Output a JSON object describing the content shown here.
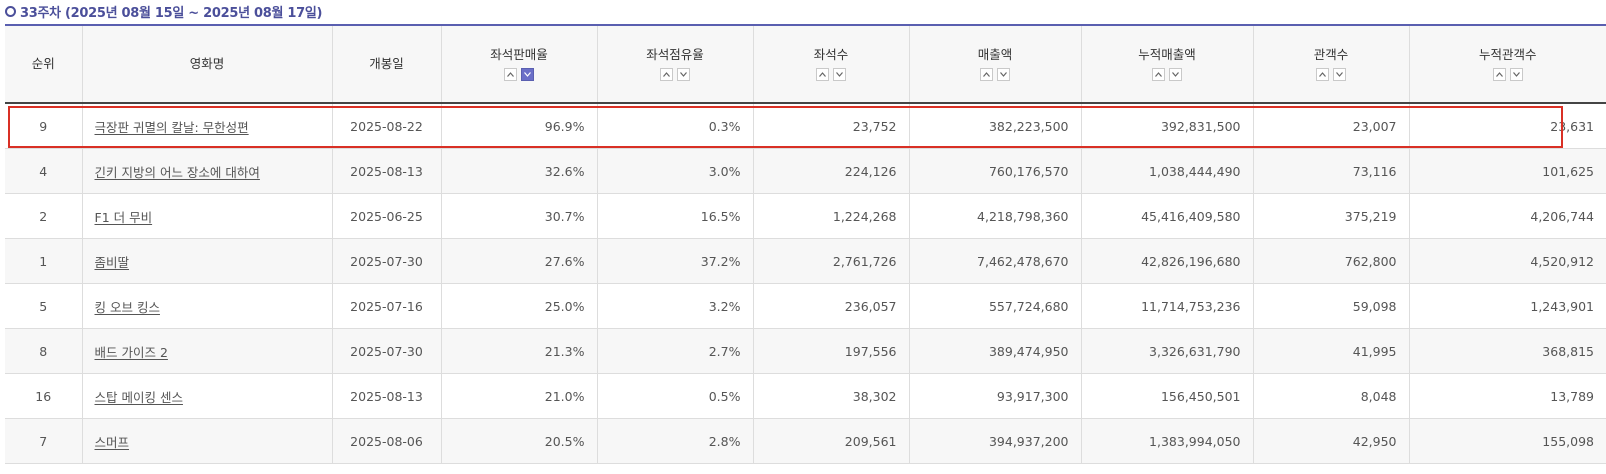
{
  "section": {
    "title": "33주차 (2025년 08월 15일 ~ 2025년 08월 17일)"
  },
  "table": {
    "columns": [
      {
        "key": "rank",
        "label": "순위",
        "sortable": false
      },
      {
        "key": "title",
        "label": "영화명",
        "sortable": false
      },
      {
        "key": "release_date",
        "label": "개봉일",
        "sortable": false
      },
      {
        "key": "seat_sales_rate",
        "label": "좌석판매율",
        "sortable": true,
        "active": "down"
      },
      {
        "key": "seat_share",
        "label": "좌석점유율",
        "sortable": true
      },
      {
        "key": "seats",
        "label": "좌석수",
        "sortable": true
      },
      {
        "key": "revenue",
        "label": "매출액",
        "sortable": true
      },
      {
        "key": "cum_revenue",
        "label": "누적매출액",
        "sortable": true
      },
      {
        "key": "audience",
        "label": "관객수",
        "sortable": true
      },
      {
        "key": "cum_audience",
        "label": "누적관객수",
        "sortable": true
      }
    ],
    "rows": [
      {
        "rank": "9",
        "title": "극장판 귀멸의 칼날: 무한성편",
        "release_date": "2025-08-22",
        "seat_sales_rate": "96.9%",
        "seat_share": "0.3%",
        "seats": "23,752",
        "revenue": "382,223,500",
        "cum_revenue": "392,831,500",
        "audience": "23,007",
        "cum_audience": "23,631",
        "highlighted": true
      },
      {
        "rank": "4",
        "title": "긴키 지방의 어느 장소에 대하여",
        "release_date": "2025-08-13",
        "seat_sales_rate": "32.6%",
        "seat_share": "3.0%",
        "seats": "224,126",
        "revenue": "760,176,570",
        "cum_revenue": "1,038,444,490",
        "audience": "73,116",
        "cum_audience": "101,625"
      },
      {
        "rank": "2",
        "title": "F1 더 무비",
        "release_date": "2025-06-25",
        "seat_sales_rate": "30.7%",
        "seat_share": "16.5%",
        "seats": "1,224,268",
        "revenue": "4,218,798,360",
        "cum_revenue": "45,416,409,580",
        "audience": "375,219",
        "cum_audience": "4,206,744"
      },
      {
        "rank": "1",
        "title": "좀비딸",
        "release_date": "2025-07-30",
        "seat_sales_rate": "27.6%",
        "seat_share": "37.2%",
        "seats": "2,761,726",
        "revenue": "7,462,478,670",
        "cum_revenue": "42,826,196,680",
        "audience": "762,800",
        "cum_audience": "4,520,912"
      },
      {
        "rank": "5",
        "title": "킹 오브 킹스",
        "release_date": "2025-07-16",
        "seat_sales_rate": "25.0%",
        "seat_share": "3.2%",
        "seats": "236,057",
        "revenue": "557,724,680",
        "cum_revenue": "11,714,753,236",
        "audience": "59,098",
        "cum_audience": "1,243,901"
      },
      {
        "rank": "8",
        "title": "배드 가이즈 2",
        "release_date": "2025-07-30",
        "seat_sales_rate": "21.3%",
        "seat_share": "2.7%",
        "seats": "197,556",
        "revenue": "389,474,950",
        "cum_revenue": "3,326,631,790",
        "audience": "41,995",
        "cum_audience": "368,815"
      },
      {
        "rank": "16",
        "title": "스탑 메이킹 센스",
        "release_date": "2025-08-13",
        "seat_sales_rate": "21.0%",
        "seat_share": "0.5%",
        "seats": "38,302",
        "revenue": "93,917,300",
        "cum_revenue": "156,450,501",
        "audience": "8,048",
        "cum_audience": "13,789"
      },
      {
        "rank": "7",
        "title": "스머프",
        "release_date": "2025-08-06",
        "seat_sales_rate": "20.5%",
        "seat_share": "2.8%",
        "seats": "209,561",
        "revenue": "394,937,200",
        "cum_revenue": "1,383,994,050",
        "audience": "42,950",
        "cum_audience": "155,098"
      }
    ]
  },
  "colors": {
    "accent": "#5a5fb0",
    "sort_active": "#6b6fc8",
    "highlight_border": "#d93025"
  },
  "icons": {
    "sort_up": "chevron-up-icon",
    "sort_down": "chevron-down-icon",
    "section_bullet": "circle-bullet-icon"
  }
}
